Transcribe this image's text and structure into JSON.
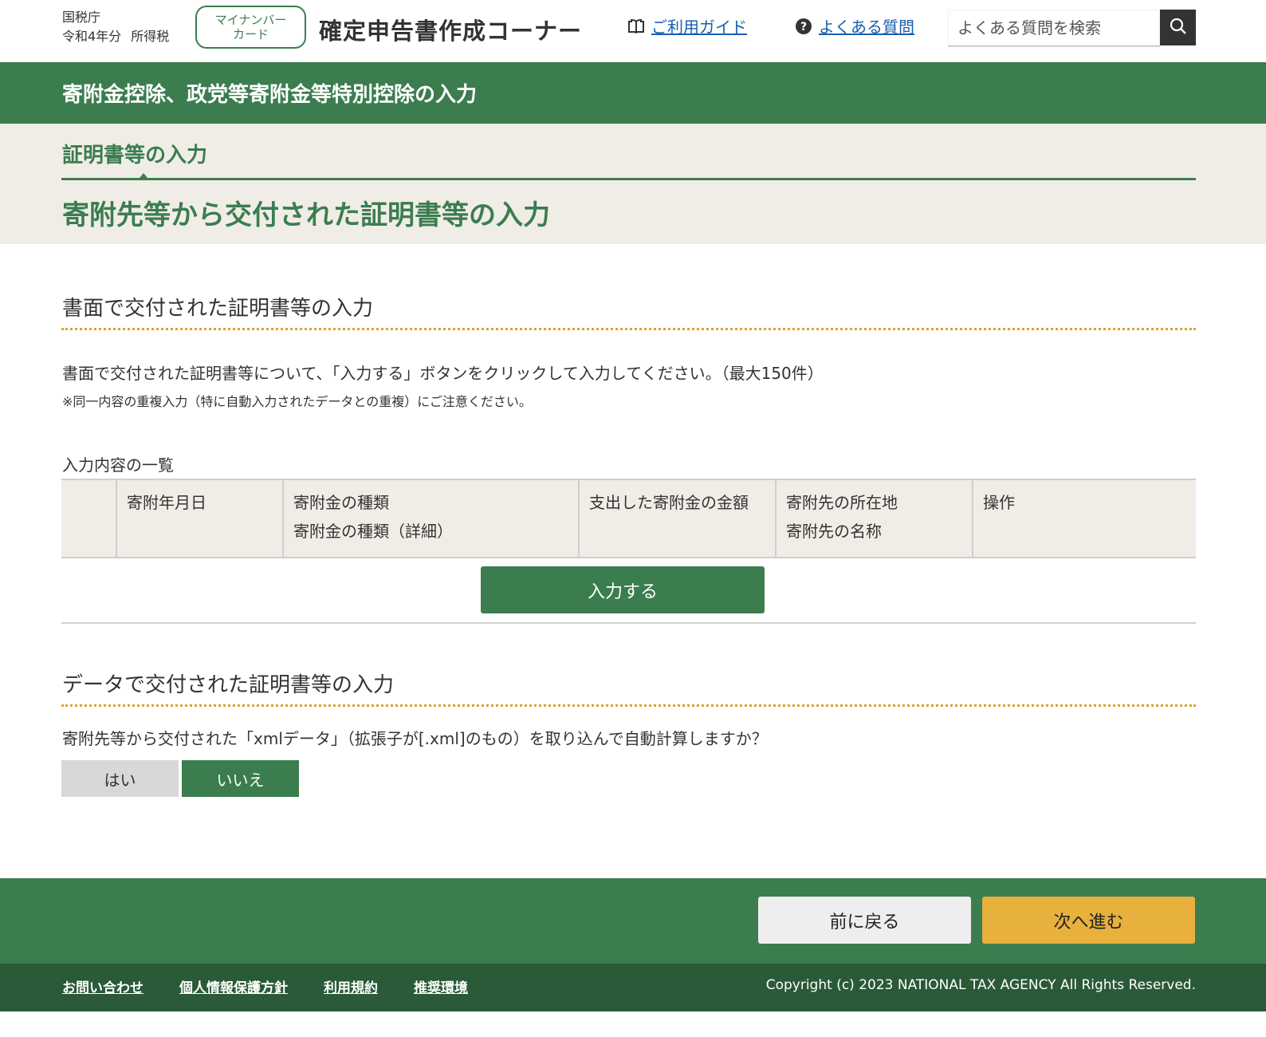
{
  "header": {
    "org": "国税庁",
    "year": "令和4年分",
    "tax_type": "所得税",
    "mynumber_line1": "マイナンバー",
    "mynumber_line2": "カード",
    "site_title": "確定申告書作成コーナー",
    "guide_link": "ご利用ガイド",
    "faq_link": "よくある質問",
    "search_placeholder": "よくある質問を検索",
    "icons": {
      "guide": "book-icon",
      "faq": "question-circle-icon",
      "search": "search-icon"
    }
  },
  "titlebar": {
    "title": "寄附金控除、政党等寄附金等特別控除の入力"
  },
  "step": {
    "label": "証明書等の入力",
    "page_title": "寄附先等から交付された証明書等の入力"
  },
  "paper_section": {
    "title": "書面で交付された証明書等の入力",
    "description": "書面で交付された証明書等について、「入力する」ボタンをクリックして入力してください。（最大150件）",
    "note": "※同一内容の重複入力（特に自動入力されたデータとの重複）にご注意ください。",
    "list_label": "入力内容の一覧",
    "table": {
      "headers": [
        {
          "line1": "",
          "line2": ""
        },
        {
          "line1": "寄附年月日",
          "line2": ""
        },
        {
          "line1": "寄附金の種類",
          "line2": "寄附金の種類（詳細）"
        },
        {
          "line1": "支出した寄附金の金額",
          "line2": ""
        },
        {
          "line1": "寄附先の所在地",
          "line2": "寄附先の名称"
        },
        {
          "line1": "操作",
          "line2": ""
        }
      ],
      "rows": []
    },
    "input_button": "入力する"
  },
  "data_section": {
    "title": "データで交付された証明書等の入力",
    "question": "寄附先等から交付された「xmlデータ」（拡張子が[.xml]のもの）を取り込んで自動計算しますか？",
    "yes_label": "はい",
    "no_label": "いいえ",
    "selected": "いいえ"
  },
  "footer": {
    "back_button": "前に戻る",
    "next_button": "次へ進む",
    "links": [
      "お問い合わせ",
      "個人情報保護方針",
      "利用規約",
      "推奨環境"
    ],
    "copyright": "Copyright (c) 2023 NATIONAL TAX AGENCY All Rights Reserved."
  },
  "colors": {
    "primary_green": "#3b7d4f",
    "dark_green": "#2a5a37",
    "beige": "#f0ede6",
    "accent_orange": "#e8b03c",
    "link_blue": "#1a5eb0"
  }
}
